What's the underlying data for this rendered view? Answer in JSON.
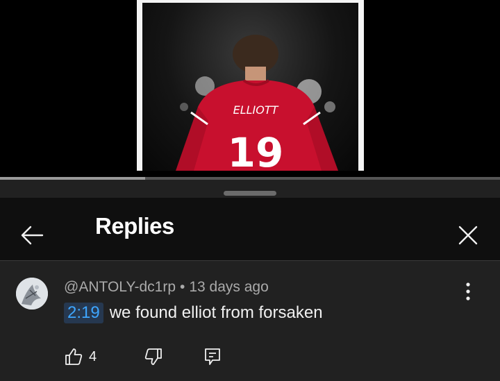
{
  "video": {
    "thumbnail": {
      "description_icon": "player-photo",
      "jersey_name": "ELLIOTT",
      "jersey_number": "19"
    },
    "progress": 0.29
  },
  "header": {
    "title": "Replies",
    "back_icon": "arrow-left-icon",
    "close_icon": "close-icon"
  },
  "comment": {
    "author": "@ANTOLY-dc1rp",
    "separator": "•",
    "age": "13 days ago",
    "timestamp": "2:19",
    "text": "we found elliot from forsaken",
    "likes": "4"
  },
  "colors": {
    "sheet_bg": "#212121",
    "header_bg": "#0f0f0f",
    "timestamp_link": "#3ea6ff",
    "secondary_text": "#aaaaaa"
  }
}
